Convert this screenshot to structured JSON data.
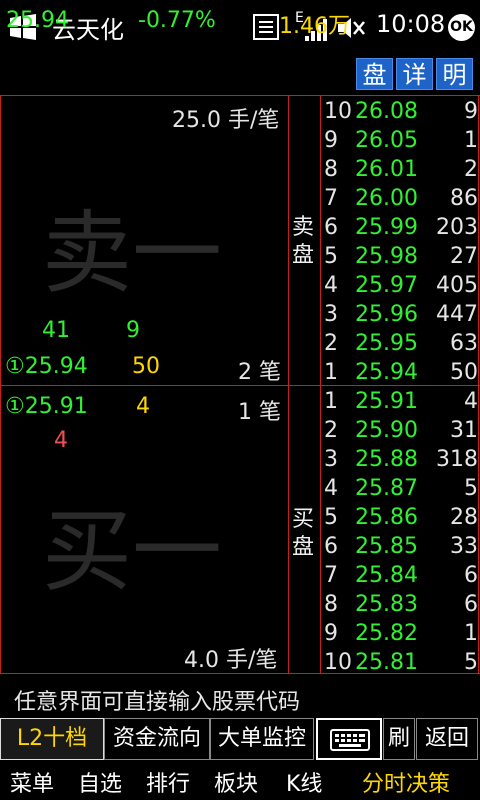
{
  "status_bar": {
    "app_title": "云天化",
    "signal_label": "E",
    "time": "10:08",
    "ok_label": "OK"
  },
  "quote": {
    "price": "25.94",
    "change_pct": "-0.77%",
    "volume": "1.46万",
    "tabs": [
      "盘",
      "详",
      "明"
    ]
  },
  "sell_panel": {
    "per_trade": "25.0 手/笔",
    "big_label": "卖一",
    "queue": [
      "41",
      "9"
    ],
    "level_price": "①25.94",
    "level_qty": "50",
    "trades": "2 笔",
    "side_label": "卖\n盘"
  },
  "buy_panel": {
    "level_price": "①25.91",
    "level_qty": "4",
    "trades": "1 笔",
    "queue": [
      "4"
    ],
    "big_label": "买一",
    "per_trade": "4.0 手/笔",
    "side_label": "买\n盘"
  },
  "sell_levels": [
    {
      "level": "10",
      "price": "26.08",
      "qty": "9"
    },
    {
      "level": "9",
      "price": "26.05",
      "qty": "1"
    },
    {
      "level": "8",
      "price": "26.01",
      "qty": "2"
    },
    {
      "level": "7",
      "price": "26.00",
      "qty": "86"
    },
    {
      "level": "6",
      "price": "25.99",
      "qty": "203"
    },
    {
      "level": "5",
      "price": "25.98",
      "qty": "27"
    },
    {
      "level": "4",
      "price": "25.97",
      "qty": "405"
    },
    {
      "level": "3",
      "price": "25.96",
      "qty": "447"
    },
    {
      "level": "2",
      "price": "25.95",
      "qty": "63"
    },
    {
      "level": "1",
      "price": "25.94",
      "qty": "50"
    }
  ],
  "buy_levels": [
    {
      "level": "1",
      "price": "25.91",
      "qty": "4"
    },
    {
      "level": "2",
      "price": "25.90",
      "qty": "31"
    },
    {
      "level": "3",
      "price": "25.88",
      "qty": "318"
    },
    {
      "level": "4",
      "price": "25.87",
      "qty": "5"
    },
    {
      "level": "5",
      "price": "25.86",
      "qty": "28"
    },
    {
      "level": "6",
      "price": "25.85",
      "qty": "33"
    },
    {
      "level": "7",
      "price": "25.84",
      "qty": "6"
    },
    {
      "level": "8",
      "price": "25.83",
      "qty": "6"
    },
    {
      "level": "9",
      "price": "25.82",
      "qty": "1"
    },
    {
      "level": "10",
      "price": "25.81",
      "qty": "5"
    }
  ],
  "hint": "任意界面可直接输入股票代码",
  "toolbar": {
    "l2": "L2十档",
    "flow": "资金流向",
    "monitor": "大单监控",
    "keyboard_icon": "keyboard-icon",
    "refresh": "刷",
    "back": "返回"
  },
  "menu": [
    "菜单",
    "自选",
    "排行",
    "板块",
    "K线",
    "分时决策"
  ],
  "colors": {
    "up": "#32f032",
    "accent": "#ffd700",
    "down": "#f05050",
    "tab": "#1e64c8",
    "grid": "#c81e1e"
  }
}
